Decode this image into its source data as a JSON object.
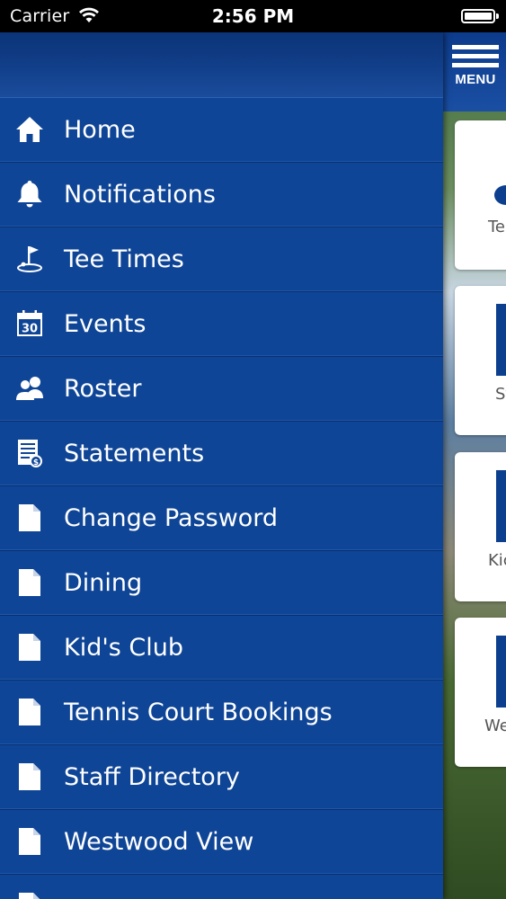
{
  "status_bar": {
    "carrier": "Carrier",
    "time": "2:56 PM"
  },
  "header": {
    "menu_label": "MENU"
  },
  "drawer": {
    "items": [
      {
        "label": "Home",
        "icon": "home-icon"
      },
      {
        "label": "Notifications",
        "icon": "bell-icon"
      },
      {
        "label": "Tee Times",
        "icon": "golf-flag-icon"
      },
      {
        "label": "Events",
        "icon": "calendar-icon"
      },
      {
        "label": "Roster",
        "icon": "people-icon"
      },
      {
        "label": "Statements",
        "icon": "statement-icon"
      },
      {
        "label": "Change Password",
        "icon": "document-icon"
      },
      {
        "label": "Dining",
        "icon": "document-icon"
      },
      {
        "label": "Kid's Club",
        "icon": "document-icon"
      },
      {
        "label": "Tennis Court Bookings",
        "icon": "document-icon"
      },
      {
        "label": "Staff Directory",
        "icon": "document-icon"
      },
      {
        "label": "Westwood View",
        "icon": "document-icon"
      },
      {
        "label": "",
        "icon": "document-icon"
      }
    ],
    "calendar_day": "30"
  },
  "content": {
    "tiles": [
      {
        "label": "Te"
      },
      {
        "label": "Sta"
      },
      {
        "label": "Kic"
      },
      {
        "label": "We"
      }
    ]
  },
  "colors": {
    "drawer_bg": "#0f4596",
    "accent": "#0d3f8f",
    "text": "#ffffff"
  }
}
